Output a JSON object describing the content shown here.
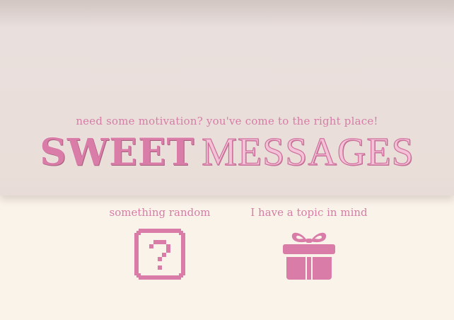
{
  "hero": {
    "tagline": "need some motivation? you've come to the right place!",
    "title_part1": "SWEET",
    "title_part2": "MESSAGES"
  },
  "options": [
    {
      "label": "something random",
      "icon": "question-mark-box-icon"
    },
    {
      "label": "I have a topic in mind",
      "icon": "gift-icon"
    }
  ],
  "colors": {
    "accent_pink": "#d97ca8",
    "hero_background": "#eaded9",
    "page_background": "#faf3ea"
  }
}
